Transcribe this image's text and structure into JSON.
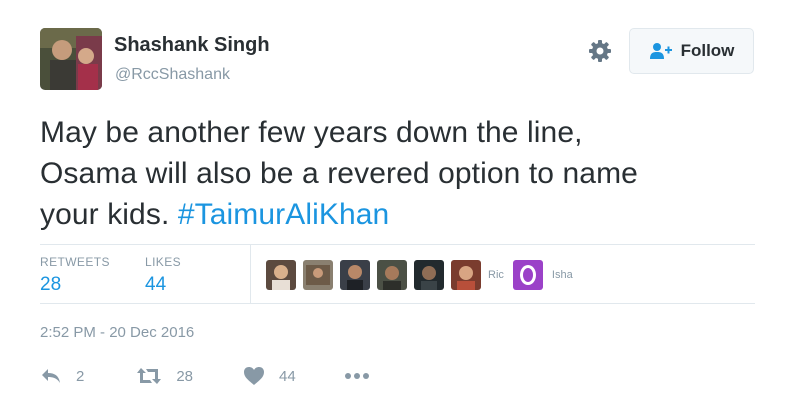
{
  "tweet": {
    "author_name": "Shashank Singh",
    "author_handle": "@RccShashank",
    "follow_label": "Follow",
    "text_line1": "May be another few years down the line,",
    "text_line2": "Osama will also be a revered option to name",
    "text_line3_prefix": "your kids. ",
    "hashtag": "#TaimurAliKhan",
    "retweets_label": "RETWEETS",
    "retweets_count": "28",
    "likes_label": "LIKES",
    "likes_count": "44",
    "liker_tag_1": "Ric",
    "liker_tag_2": "Isha",
    "timestamp": "2:52 PM - 20 Dec 2016",
    "reply_count": "2",
    "retweet_action_count": "28",
    "like_action_count": "44"
  },
  "icons": {
    "settings": "gear-icon",
    "follow": "add-user-icon",
    "reply": "reply-icon",
    "retweet": "retweet-icon",
    "like": "heart-icon",
    "more": "more-icon"
  },
  "colors": {
    "link": "#1b95e0",
    "muted": "#8899a6",
    "text": "#292f33",
    "liker_purple": "#9b41c8"
  }
}
